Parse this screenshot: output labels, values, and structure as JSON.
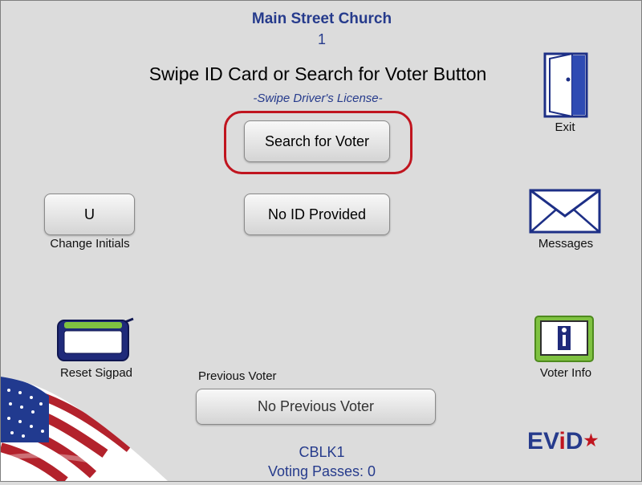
{
  "header": {
    "location": "Main Street Church",
    "station": "1",
    "instruction": "Swipe ID Card or Search for Voter Button",
    "subinstruction": "-Swipe Driver's License-"
  },
  "buttons": {
    "search_voter": "Search for Voter",
    "no_id": "No ID Provided",
    "initials": "U",
    "previous_voter": "No Previous Voter"
  },
  "labels": {
    "exit": "Exit",
    "change_initials": "Change Initials",
    "messages": "Messages",
    "reset_sigpad": "Reset Sigpad",
    "voter_info": "Voter Info",
    "previous_voter": "Previous Voter"
  },
  "footer": {
    "code": "CBLK1",
    "voting_passes": "Voting Passes: 0"
  },
  "brand": {
    "logo_prefix": "EV",
    "logo_i": "i",
    "logo_suffix": "D",
    "star": "★"
  },
  "colors": {
    "accent_blue": "#263b8c",
    "highlight_red": "#c0151f",
    "background": "#dcdcdc"
  },
  "icons": [
    "exit-door-icon",
    "envelope-icon",
    "signature-pad-icon",
    "voter-info-icon",
    "american-flag-decoration"
  ]
}
